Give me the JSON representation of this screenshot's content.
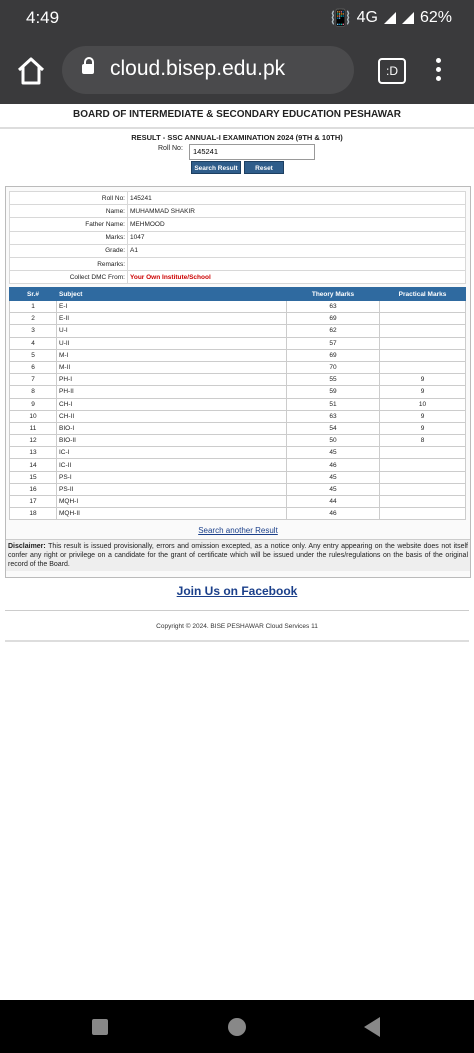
{
  "status": {
    "time": "4:49",
    "network": "4G",
    "battery": "62%"
  },
  "browser": {
    "url": "cloud.bisep.edu.pk",
    "tab_icon_label": ":D"
  },
  "page": {
    "board_title": "BOARD OF INTERMEDIATE & SECONDARY EDUCATION PESHAWAR",
    "result_title": "RESULT - SSC ANNUAL-I EXAMINATION 2024 (9TH & 10TH)",
    "roll_label": "Roll No:",
    "roll_value": "145241",
    "search_button": "Search Result",
    "reset_button": "Reset"
  },
  "info": [
    {
      "label": "Roll No:",
      "value": "145241"
    },
    {
      "label": "Name:",
      "value": "MUHAMMAD SHAKIR"
    },
    {
      "label": "Father Name:",
      "value": "MEHMOOD"
    },
    {
      "label": "Marks:",
      "value": "1047"
    },
    {
      "label": "Grade:",
      "value": "A1"
    },
    {
      "label": "Remarks:",
      "value": ""
    },
    {
      "label": "Collect DMC From:",
      "value": "Your Own Institute/School"
    }
  ],
  "marks_table": {
    "headers": [
      "Sr.#",
      "Subject",
      "Theory Marks",
      "Practical Marks"
    ],
    "rows": [
      [
        "1",
        "E-I",
        "63",
        ""
      ],
      [
        "2",
        "E-II",
        "69",
        ""
      ],
      [
        "3",
        "U-I",
        "62",
        ""
      ],
      [
        "4",
        "U-II",
        "57",
        ""
      ],
      [
        "5",
        "M-I",
        "69",
        ""
      ],
      [
        "6",
        "M-II",
        "70",
        ""
      ],
      [
        "7",
        "PH-I",
        "55",
        "9"
      ],
      [
        "8",
        "PH-II",
        "59",
        "9"
      ],
      [
        "9",
        "CH-I",
        "51",
        "10"
      ],
      [
        "10",
        "CH-II",
        "63",
        "9"
      ],
      [
        "11",
        "BIO-I",
        "54",
        "9"
      ],
      [
        "12",
        "BIO-II",
        "50",
        "8"
      ],
      [
        "13",
        "IC-I",
        "45",
        ""
      ],
      [
        "14",
        "IC-II",
        "46",
        ""
      ],
      [
        "15",
        "PS-I",
        "45",
        ""
      ],
      [
        "16",
        "PS-II",
        "45",
        ""
      ],
      [
        "17",
        "MQH-I",
        "44",
        ""
      ],
      [
        "18",
        "MQH-II",
        "46",
        ""
      ]
    ]
  },
  "search_another": "Search another Result",
  "disclaimer": {
    "label": "Disclaimer:",
    "text": "This result is issued provisionally, errors and omission excepted, as a notice only. Any entry appearing on the website does not itself confer any right or privilege on a candidate for the grant of certificate which will be issued under the rules/regulations on the basis of the original record of the Board."
  },
  "facebook_link": "Join Us on Facebook",
  "copyright": "Copyright © 2024. BISE PESHAWAR Cloud Services 11",
  "colors": {
    "header_blue": "#2f6aa0",
    "link_blue": "#1a3f8a",
    "dmc_red": "#cc0000"
  }
}
